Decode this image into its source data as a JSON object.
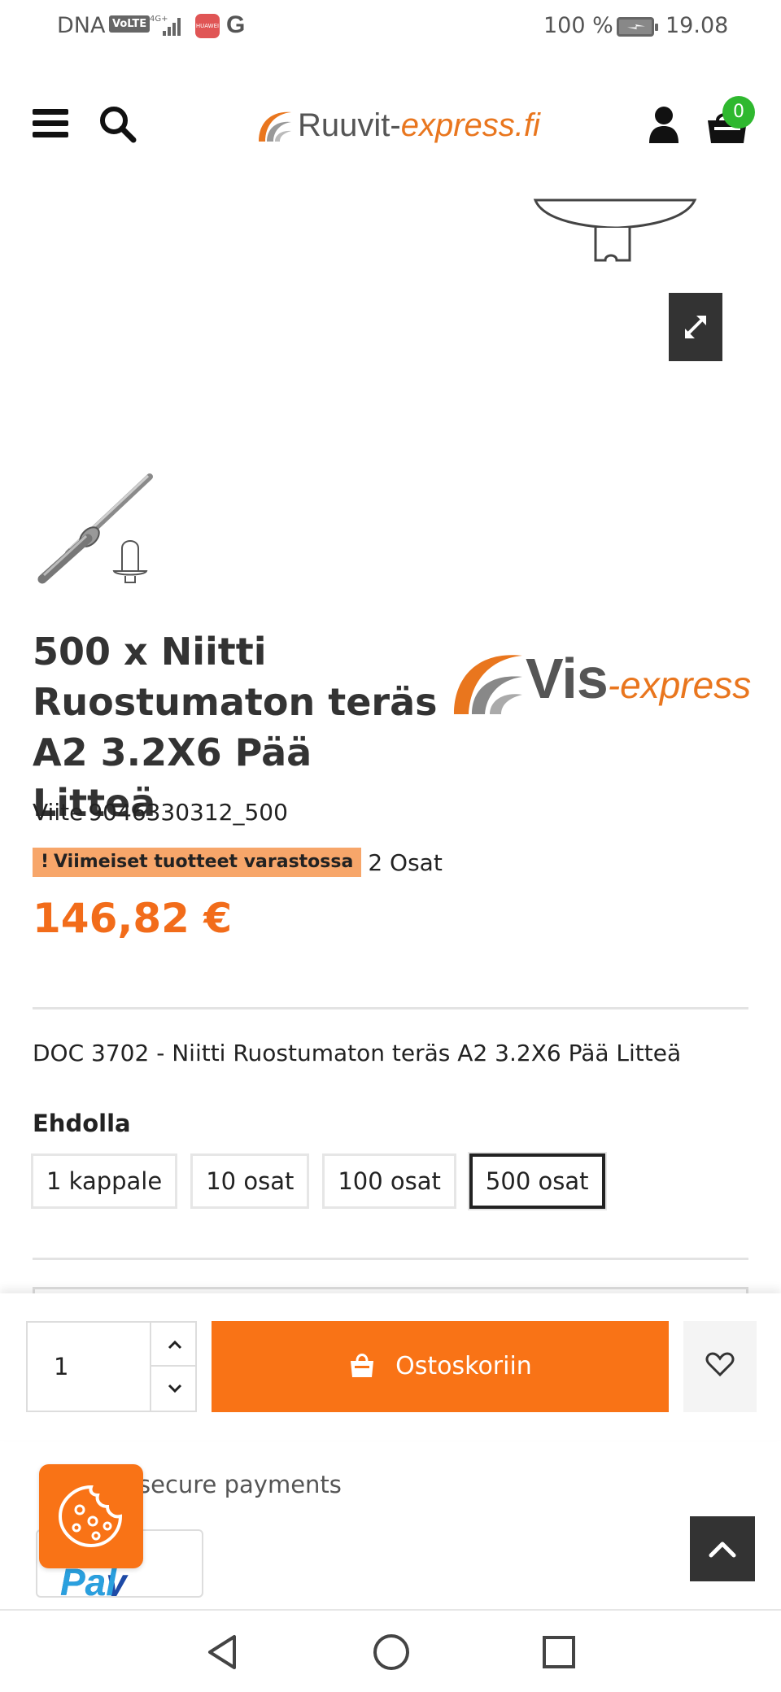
{
  "status_bar": {
    "carrier": "DNA",
    "volte": "VoLTE",
    "network": "4G+",
    "app_icon": "HUAWEI",
    "g_icon": "G",
    "battery_pct": "100 %",
    "time": "19.08"
  },
  "header": {
    "logo_main": "Ruuvit-",
    "logo_accent": "express.fi",
    "cart_count": "0"
  },
  "product": {
    "title": "500 x Niitti Ruostumaton teräs A2 3.2X6 Pää Litteä",
    "brand_main": "Vis",
    "brand_accent": "-express",
    "reference_label": "Viite",
    "reference_value": "9046330312_500",
    "stock_badge": "Viimeiset tuotteet varastossa",
    "stock_icon": "!",
    "stock_count": "2 Osat",
    "price": "146,82 €",
    "description": "DOC 3702 - Niitti Ruostumaton teräs A2 3.2X6 Pää Litteä",
    "variant_label": "Ehdolla",
    "variants": [
      "1 kappale",
      "10 osat",
      "100 osat",
      "500 osat"
    ],
    "selected_variant": "500 osat"
  },
  "cart_bar": {
    "quantity": "1",
    "add_to_cart": "Ostoskoriin"
  },
  "payments": {
    "label": "secure payments",
    "paypal_dark": "Pay",
    "paypal_light": "Pal"
  },
  "colors": {
    "accent": "#f97316",
    "price": "#f26c1a",
    "badge_bg": "#f7a66a",
    "cart_badge": "#2fb82f"
  }
}
